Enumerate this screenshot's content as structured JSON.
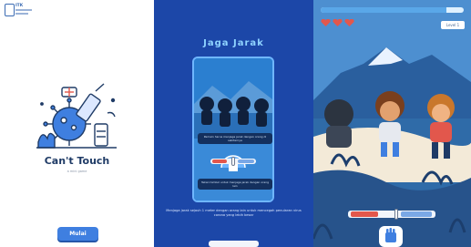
{
  "screens": {
    "title_screen": {
      "logo_text": "ITK",
      "game_title": "Can't Touch",
      "game_subtitle": "a mini game",
      "start_button": "Mulai"
    },
    "tutorial_screen": {
      "title": "Jaga Jarak",
      "bubble_top": "Pemain harus menjaga jarak dengan orang di sekitarnya",
      "bubble_bottom": "Tekan tombol untuk menjaga jarak dengan orang lain",
      "instruction": "Menjaga jarak sejauh 1 meter dengan orang lain untuk mencegah penularan virus corona yang lebih besar"
    },
    "gameplay_screen": {
      "progress": 0.88,
      "hearts": 3,
      "level_label": "Level 1",
      "distance_indicator": 0.55
    }
  },
  "colors": {
    "primary_blue": "#3f7fe0",
    "panel_blue": "#1c47a8",
    "title_cyan": "#8fd3ff",
    "heart_red": "#e2574c"
  }
}
